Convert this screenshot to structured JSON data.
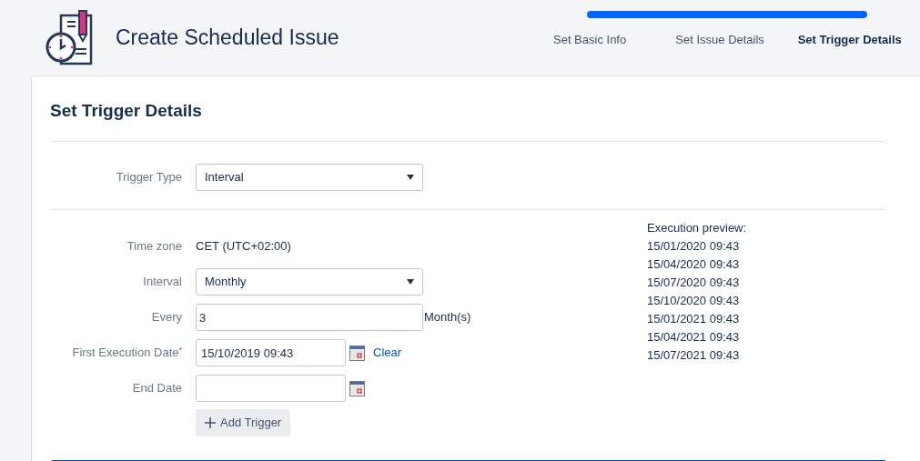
{
  "header": {
    "title": "Create Scheduled Issue",
    "steps": [
      {
        "label": "Set Basic Info",
        "selected": false
      },
      {
        "label": "Set Issue Details",
        "selected": false
      },
      {
        "label": "Set Trigger Details",
        "selected": true
      }
    ]
  },
  "section": {
    "title": "Set Trigger Details",
    "trigger_type": {
      "label": "Trigger Type",
      "value": "Interval"
    },
    "rows": [
      {
        "kind": "text",
        "label": "Time zone",
        "value": "CET (UTC+02:00)"
      },
      {
        "kind": "select",
        "label": "Interval",
        "value": "Monthly"
      },
      {
        "kind": "input",
        "label": "Every",
        "value": "3",
        "suffix": "Month(s)"
      },
      {
        "kind": "date",
        "label": "First Execution Date",
        "required_mark": "*",
        "value": "15/10/2019 09:43",
        "clear": "Clear"
      },
      {
        "kind": "date",
        "label": "End Date"
      }
    ],
    "add_button": "Add Trigger",
    "preview": {
      "title": "Execution preview:",
      "dates": [
        "15/01/2020 09:43",
        "15/04/2020 09:43",
        "15/07/2020 09:43",
        "15/10/2020 09:43",
        "15/01/2021 09:43",
        "15/04/2021 09:43",
        "15/07/2021 09:43"
      ]
    }
  }
}
